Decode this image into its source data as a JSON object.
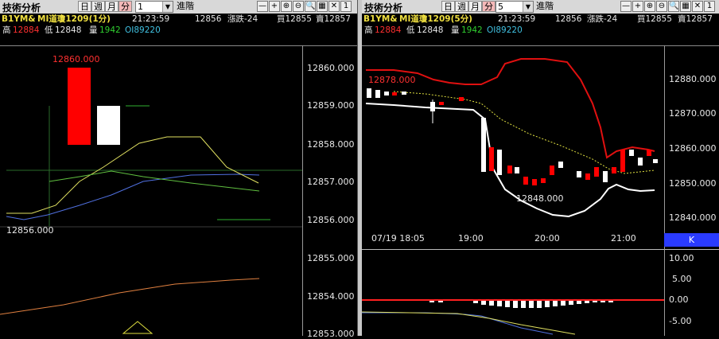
{
  "left": {
    "title": "技術分析",
    "periods": [
      "日",
      "週",
      "月",
      "分"
    ],
    "active_period": "分",
    "interval": "1",
    "go_label": "進階",
    "icons": [
      "minus-icon",
      "plus-icon",
      "zoom-in-icon",
      "zoom-out-icon",
      "search-icon",
      "chart-icon",
      "close-icon",
      "pin-icon"
    ],
    "icon_glyphs": [
      "—",
      "+",
      "⊕",
      "⊖",
      "🔍",
      "▦",
      "✕",
      "1"
    ],
    "symbol": "B1YM&",
    "instrument": "MI道瓊1209(1分)",
    "time": "21:23:59",
    "last": "12856",
    "change": "漲跌-24",
    "bid": "買12855",
    "ask": "賣12857",
    "high_label": "高",
    "high": "12884",
    "low_label": "低",
    "low": "12848",
    "vol_label": "量",
    "vol": "1942",
    "oi": "OI89220",
    "y_ticks": [
      "12860.000",
      "12859.000",
      "12858.000",
      "12857.000",
      "12856.000",
      "12855.000",
      "12854.000",
      "12853.000"
    ],
    "high_annot": "12860.000",
    "low_annot": "12856.000"
  },
  "right": {
    "title": "技術分析",
    "periods": [
      "日",
      "週",
      "月",
      "分"
    ],
    "active_period": "分",
    "interval": "5",
    "go_label": "進階",
    "icons": [
      "minus-icon",
      "plus-icon",
      "zoom-in-icon",
      "zoom-out-icon",
      "search-icon",
      "chart-icon",
      "close-icon",
      "pin-icon"
    ],
    "icon_glyphs": [
      "—",
      "+",
      "⊕",
      "⊖",
      "🔍",
      "▦",
      "✕",
      "1"
    ],
    "symbol": "B1YM&",
    "instrument": "MI道瓊1209(5分)",
    "time": "21:23:59",
    "last": "12856",
    "change": "漲跌-24",
    "bid": "買12855",
    "ask": "賣12857",
    "high_label": "高",
    "high": "12884",
    "low_label": "低",
    "low": "12848",
    "vol_label": "量",
    "vol": "1942",
    "oi": "OI89220",
    "y_ticks": [
      "12880.000",
      "12870.000",
      "12860.000",
      "12850.000",
      "12840.000"
    ],
    "x_ticks": [
      "07/19 18:05",
      "19:00",
      "20:00",
      "21:00"
    ],
    "k_label": "K",
    "high_annot": "12878.000",
    "low_annot": "12848.000",
    "osc_ticks": [
      "10.00",
      "5.00",
      "0.00",
      "-5.00"
    ]
  },
  "colors": {
    "up": "#ff0000",
    "down": "#ffffff",
    "upper_band": "#e01010",
    "lower_band": "#ffffff",
    "mid_band": "#e0e040",
    "ma_blue": "#5070e0",
    "ma_yellow": "#e0e060",
    "ma_green": "#60c040",
    "ma_orange": "#e08040",
    "k_bg": "#2a3bff"
  }
}
